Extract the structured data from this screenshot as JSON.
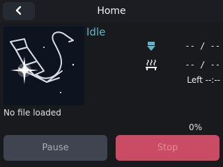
{
  "header": {
    "title": "Home",
    "back_icon": "chevron-left-icon"
  },
  "job": {
    "status": "Idle",
    "status_color": "#5fb8c7",
    "file_name": "No file loaded",
    "progress_text": "0%",
    "progress": 0,
    "time_left": "Left --:--"
  },
  "nozzle": {
    "icon": "nozzle-heater-icon",
    "value": "-- / --"
  },
  "bed": {
    "icon": "heated-bed-icon",
    "value": "-- / --"
  },
  "actions": {
    "pause_label": "Pause",
    "stop_label": "Stop"
  },
  "colors": {
    "accent": "#5fb8c7",
    "stop": "#c94c64",
    "pause": "#3f4450",
    "background": "#191a1e"
  }
}
